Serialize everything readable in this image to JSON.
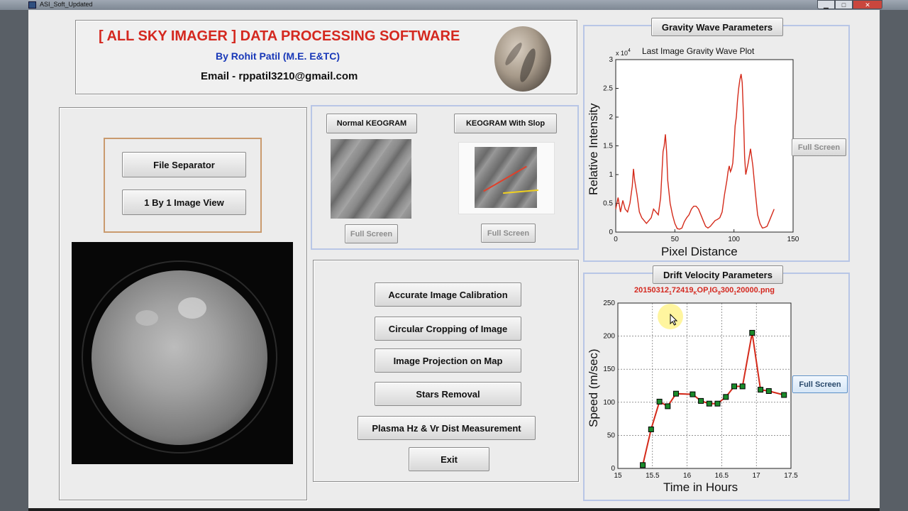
{
  "window": {
    "title": "ASI_Soft_Updated",
    "controls": {
      "minimize": "▁",
      "maximize": "□",
      "close": "✕"
    }
  },
  "header": {
    "title": "[ ALL SKY IMAGER ] DATA PROCESSING SOFTWARE",
    "author": "By Rohit Patil (M.E. E&TC)",
    "email": "Email - rppatil3210@gmail.com"
  },
  "left_panel": {
    "file_separator_label": "File Separator",
    "one_by_one_label": "1 By 1 Image View"
  },
  "keogram": {
    "normal_label": "Normal KEOGRAM",
    "slope_label": "KEOGRAM With Slop",
    "normal_fullscreen": "Full Screen",
    "slope_fullscreen": "Full Screen"
  },
  "actions": {
    "calibration": "Accurate Image Calibration",
    "cropping": "Circular Cropping of Image",
    "projection": "Image Projection on Map",
    "stars": "Stars Removal",
    "plasma": "Plasma Hz & Vr Dist Measurement",
    "exit": "Exit"
  },
  "gravity_wave": {
    "panel_title": "Gravity Wave Parameters",
    "fullscreen": "Full Screen"
  },
  "drift_velocity": {
    "panel_title": "Drift Velocity Parameters",
    "fullscreen": "Full Screen"
  },
  "colors": {
    "title_red": "#d4281f",
    "author_blue": "#1838b8",
    "plot_line": "#d42a1a",
    "marker_fill": "#1a8a2a",
    "panel_border_blue": "#b8c6e6",
    "panel_border_orange": "#c99a6e"
  },
  "chart_data": [
    {
      "type": "line",
      "title": "Last Image Gravity Wave Plot",
      "xlabel": "Pixel Distance",
      "ylabel": "Relative Intensity",
      "y_multiplier": "x 10^4",
      "xlim": [
        0,
        150
      ],
      "ylim": [
        0,
        30000
      ],
      "xticks": [
        "0",
        "50",
        "100",
        "150"
      ],
      "yticks": [
        "0",
        "0.5",
        "1",
        "1.5",
        "2",
        "2.5",
        "3"
      ],
      "grid": false,
      "series": [
        {
          "color": "#d42a1a",
          "x": [
            0,
            2,
            4,
            6,
            8,
            10,
            12,
            14,
            15,
            16,
            18,
            20,
            22,
            24,
            26,
            28,
            30,
            32,
            34,
            36,
            38,
            40,
            41,
            42,
            43,
            44,
            45,
            46,
            48,
            50,
            52,
            54,
            56,
            58,
            60,
            62,
            64,
            66,
            68,
            70,
            72,
            74,
            76,
            78,
            80,
            82,
            84,
            86,
            88,
            90,
            92,
            94,
            95,
            96,
            97,
            98,
            99,
            100,
            101,
            102,
            103,
            104,
            105,
            106,
            107,
            108,
            109,
            110,
            112,
            114,
            116,
            118,
            120,
            122,
            124,
            126,
            128,
            130,
            132,
            134
          ],
          "y": [
            4000,
            6000,
            3500,
            5500,
            4000,
            3500,
            5000,
            8000,
            11000,
            9000,
            6500,
            3500,
            2500,
            2000,
            1500,
            2000,
            2500,
            4000,
            3500,
            3000,
            6000,
            14000,
            15000,
            17000,
            14000,
            9000,
            7000,
            5000,
            3000,
            1500,
            600,
            500,
            700,
            1800,
            2500,
            3000,
            4000,
            4500,
            4500,
            4000,
            3000,
            2000,
            1000,
            700,
            1000,
            1500,
            2000,
            2200,
            2500,
            3500,
            6500,
            9000,
            10500,
            11500,
            10500,
            11000,
            12000,
            15000,
            18500,
            20000,
            23000,
            25000,
            26500,
            27500,
            26000,
            20500,
            13000,
            10000,
            12000,
            14500,
            11500,
            7000,
            3000,
            1500,
            700,
            800,
            1000,
            2000,
            3000,
            4000
          ]
        }
      ]
    },
    {
      "type": "line",
      "title": "20150312_172419_OP_IG_300_20000.png",
      "xlabel": "Time in Hours",
      "ylabel": "Speed (m/sec)",
      "xlim": [
        15,
        17.5
      ],
      "ylim": [
        0,
        250
      ],
      "xticks": [
        "15",
        "15.5",
        "16",
        "16.5",
        "17",
        "17.5"
      ],
      "yticks": [
        "0",
        "50",
        "100",
        "150",
        "200",
        "250"
      ],
      "grid": true,
      "series": [
        {
          "color": "#d42a1a",
          "marker": "square",
          "x": [
            15.36,
            15.48,
            15.6,
            15.72,
            15.84,
            16.08,
            16.2,
            16.32,
            16.44,
            16.56,
            16.68,
            16.8,
            16.94,
            17.06,
            17.18,
            17.4
          ],
          "y": [
            5,
            59,
            101,
            94,
            113,
            112,
            102,
            98,
            98,
            108,
            124,
            124,
            205,
            119,
            117,
            111
          ]
        }
      ]
    }
  ]
}
